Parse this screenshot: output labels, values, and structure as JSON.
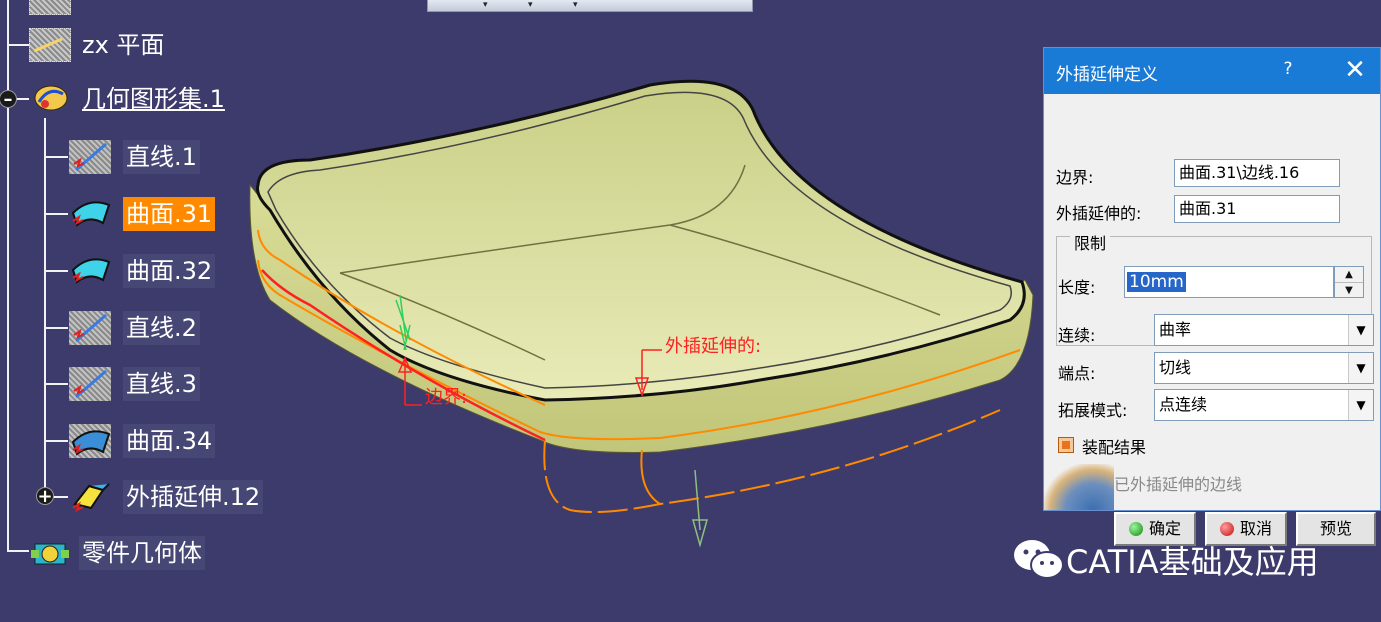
{
  "tree": {
    "nodes": [
      {
        "id": "zx",
        "label": "zx 平面",
        "icon": "plane-icon"
      },
      {
        "id": "geoset",
        "label": "几何图形集.1",
        "icon": "geometrical-set-icon"
      },
      {
        "id": "line1",
        "label": "直线.1",
        "icon": "line-icon"
      },
      {
        "id": "surf31",
        "label": "曲面.31",
        "icon": "surface-icon"
      },
      {
        "id": "surf32",
        "label": "曲面.32",
        "icon": "surface-icon"
      },
      {
        "id": "line2",
        "label": "直线.2",
        "icon": "line-icon"
      },
      {
        "id": "line3",
        "label": "直线.3",
        "icon": "line-icon"
      },
      {
        "id": "surf34",
        "label": "曲面.34",
        "icon": "surface-icon"
      },
      {
        "id": "extrap12",
        "label": "外插延伸.12",
        "icon": "extrapolate-icon"
      },
      {
        "id": "body",
        "label": "零件几何体",
        "icon": "part-body-icon"
      }
    ],
    "selected": "曲面.31"
  },
  "viewport": {
    "annotations": {
      "extrapolated": "外插延伸的:",
      "boundary": "边界:"
    },
    "colors": {
      "surface": "#dfe3a0",
      "edge_orange": "#ff8a00",
      "edge_red": "#ff2020",
      "background": "#3c3b6b"
    }
  },
  "dialog": {
    "title": "外插延伸定义",
    "help": "?",
    "close": "✕",
    "boundary_label": "边界:",
    "boundary_value": "曲面.31\\边线.16",
    "extrapolated_label": "外插延伸的:",
    "extrapolated_value": "曲面.31",
    "limit_group": "限制",
    "length_label": "长度:",
    "length_value": "10mm",
    "continuity_label": "连续:",
    "continuity_value": "曲率",
    "endpoint_label": "端点:",
    "endpoint_value": "切线",
    "propagation_label": "拓展模式:",
    "propagation_value": "点连续",
    "assemble_label": "装配结果",
    "assemble_checked": true,
    "extend_edges_label": "扩展已外插延伸的边线",
    "extend_edges_checked": false,
    "ok_label": "确定",
    "cancel_label": "取消",
    "preview_label": "预览"
  },
  "watermark": {
    "text": "CATIA基础及应用",
    "icon": "wechat-icon"
  }
}
